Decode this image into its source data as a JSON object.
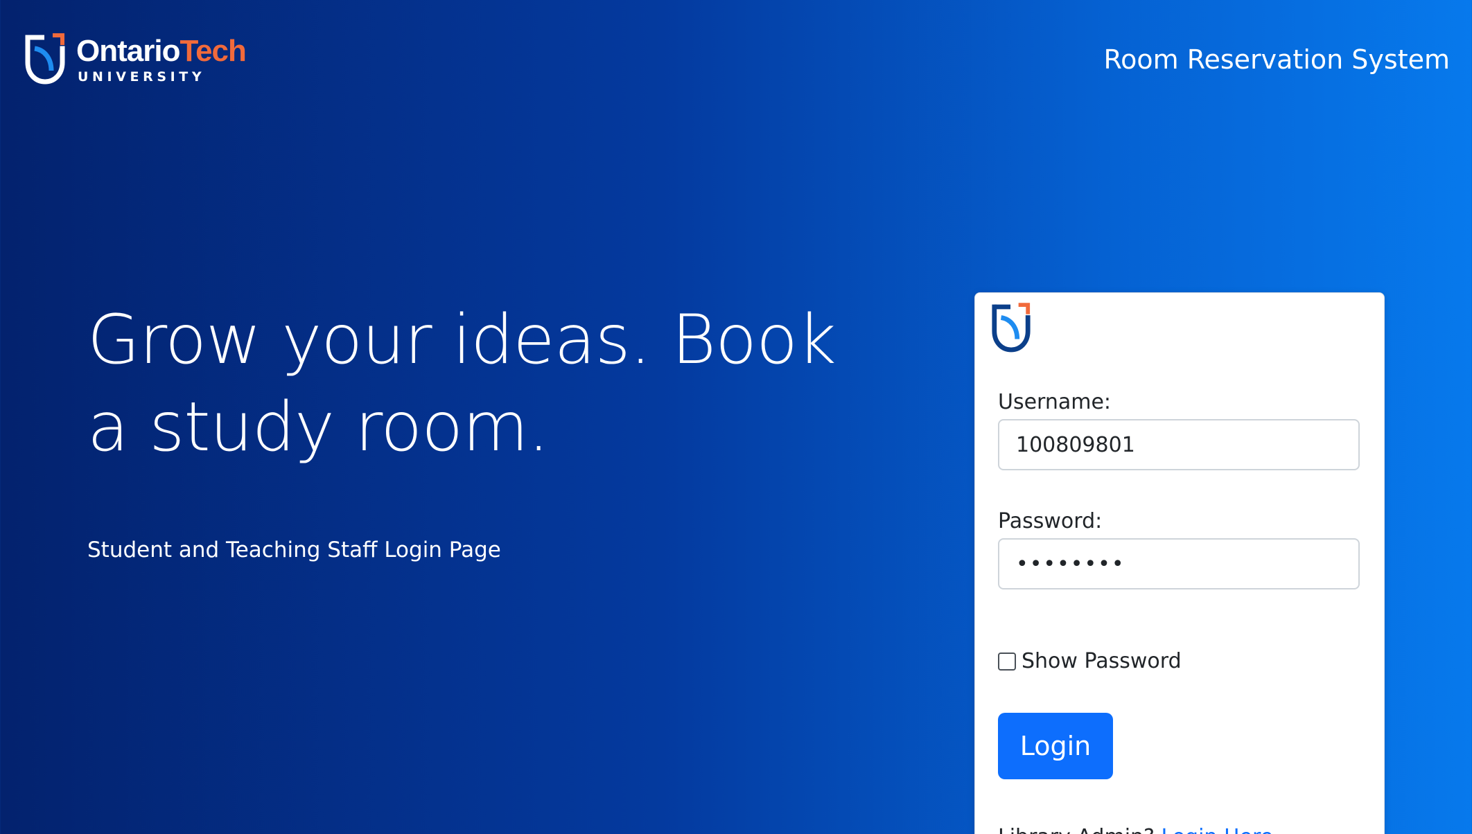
{
  "brand": {
    "word_ontario": "Ontario",
    "word_tech": "Tech",
    "sub": "UNIVERSITY",
    "accent_color": "#f16a3b",
    "shield_color": "#0b3f8a"
  },
  "header": {
    "title": "Room Reservation System"
  },
  "hero": {
    "heading": "Grow your ideas. Book a study room.",
    "subtitle": "Student and Teaching Staff Login Page"
  },
  "login_form": {
    "username_label": "Username:",
    "username_value": "100809801",
    "password_label": "Password:",
    "password_value": "••••••••",
    "show_password_label": "Show Password",
    "show_password_checked": false,
    "login_button_label": "Login",
    "admin_prompt": "Library Admin?",
    "admin_link_label": "Login Here",
    "button_color": "#0d6efd"
  },
  "icons": {
    "brand_logo": "ontario-tech-shield-icon",
    "card_logo": "ontario-tech-shield-icon"
  }
}
